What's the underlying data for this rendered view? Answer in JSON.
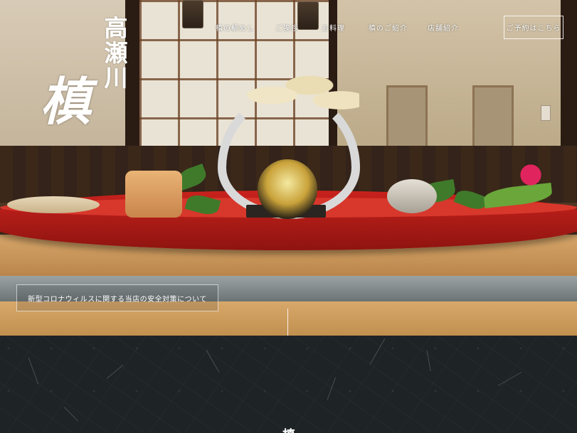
{
  "logo": {
    "place_name": "高瀬川",
    "shop_name": "槙"
  },
  "nav": {
    "items": [
      {
        "label": "槙の鯛めし"
      },
      {
        "label": "ご挨拶"
      },
      {
        "label": "お料理"
      },
      {
        "label": "槙のご紹介"
      },
      {
        "label": "店舗紹介"
      }
    ],
    "reserve_label": "ご予約はこちら"
  },
  "notice": {
    "label": "新型コロナウィルスに関する当店の安全対策について"
  },
  "section": {
    "heading_glyph": "槙"
  },
  "colors": {
    "tray_red": "#c9221d",
    "washi_dark": "#1e2326",
    "accent_stripe": "#7a2a55"
  }
}
